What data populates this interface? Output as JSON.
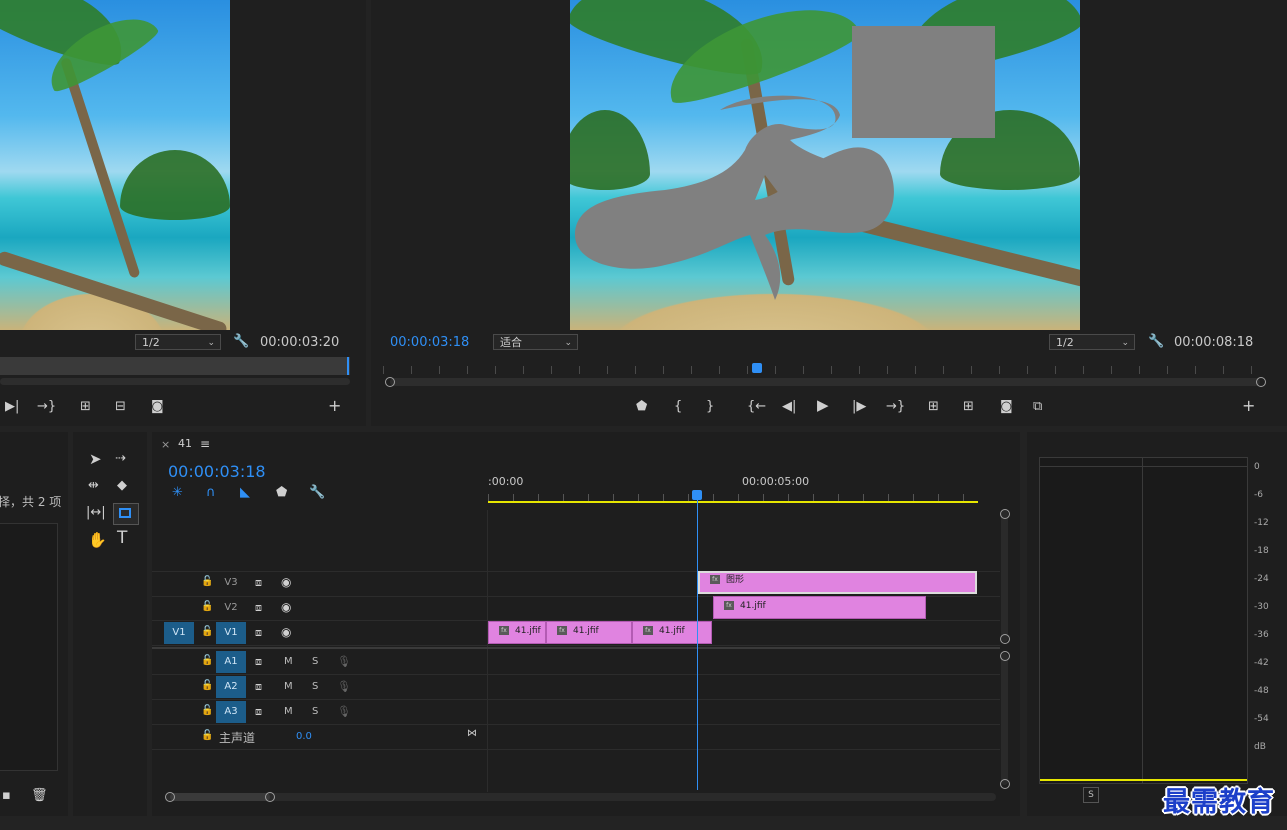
{
  "source_monitor": {
    "zoom_value": "1/2",
    "timecode": "00:00:03:20"
  },
  "program_monitor": {
    "timecode_current": "00:00:03:18",
    "fit_value": "适合",
    "zoom_value": "1/2",
    "timecode_duration": "00:00:08:18"
  },
  "project_panel": {
    "items_text": "择，共 2 项"
  },
  "timeline": {
    "tab_close": "×",
    "tab_name": "41",
    "menu_icon": "≡",
    "timecode": "00:00:03:18",
    "ruler_labels": [
      ":00:00",
      "00:00:05:00"
    ],
    "tracks": {
      "v3": {
        "label": "V3"
      },
      "v2": {
        "label": "V2"
      },
      "v1": {
        "label": "V1",
        "source_label": "V1"
      },
      "a1": {
        "label": "A1",
        "m": "M",
        "s": "S"
      },
      "a2": {
        "label": "A2",
        "m": "M",
        "s": "S"
      },
      "a3": {
        "label": "A3",
        "m": "M",
        "s": "S"
      },
      "master": {
        "label": "主声道",
        "value": "0.0"
      }
    },
    "clips": {
      "graphic": "图形",
      "v2_clip": "41.jfif",
      "v1_clip1": "41.jfif",
      "v1_clip2": "41.jfif",
      "v1_clip3": "41.jfif"
    },
    "fx_badge": "fx"
  },
  "audio_meter": {
    "scale": [
      "0",
      "-6",
      "-12",
      "-18",
      "-24",
      "-30",
      "-36",
      "-42",
      "-48",
      "-54",
      "dB"
    ],
    "solo_label": "S"
  },
  "watermark": "最需教育",
  "colors": {
    "accent_blue": "#2f8ff5",
    "clip_pink": "#e083e0",
    "track_target": "#1c5d8a",
    "work_area_yellow": "#e6e600"
  }
}
